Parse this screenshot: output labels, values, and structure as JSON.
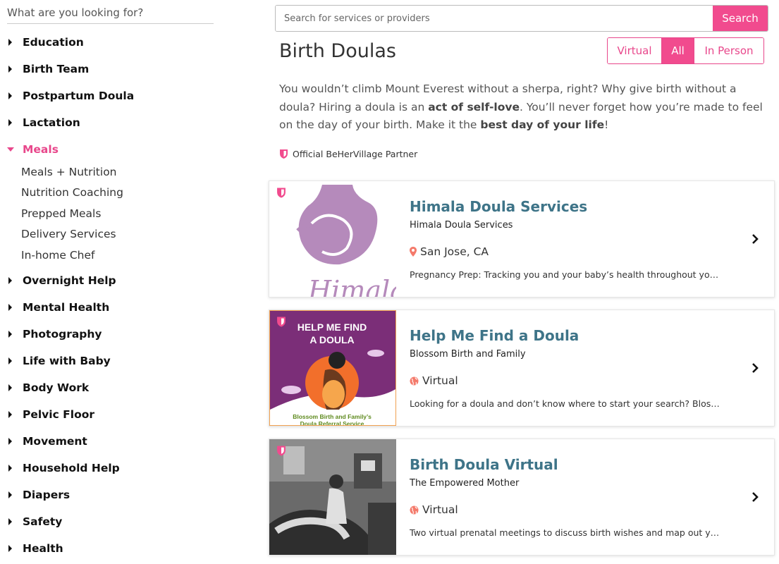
{
  "sidebar": {
    "search_placeholder": "What are you looking for?",
    "categories": [
      {
        "label": "Education"
      },
      {
        "label": "Birth Team"
      },
      {
        "label": "Postpartum Doula"
      },
      {
        "label": "Lactation"
      },
      {
        "label": "Meals"
      },
      {
        "label": "Overnight Help"
      },
      {
        "label": "Mental Health"
      },
      {
        "label": "Photography"
      },
      {
        "label": "Life with Baby"
      },
      {
        "label": "Body Work"
      },
      {
        "label": "Pelvic Floor"
      },
      {
        "label": "Movement"
      },
      {
        "label": "Household Help"
      },
      {
        "label": "Diapers"
      },
      {
        "label": "Safety"
      },
      {
        "label": "Health"
      }
    ],
    "meals_subitems": [
      "Meals + Nutrition",
      "Nutrition Coaching",
      "Prepped Meals",
      "Delivery Services",
      "In-home Chef"
    ]
  },
  "search": {
    "placeholder": "Search for services or providers",
    "button_label": "Search"
  },
  "page_title": "Birth Doulas",
  "filter": {
    "options": [
      "Virtual",
      "All",
      "In Person"
    ],
    "selected": "All"
  },
  "intro": {
    "part1": "You wouldn’t climb Mount Everest without a sherpa, right? Why give birth without a doula? Hiring a doula is an ",
    "bold1": "act of self-love",
    "part2": ". You’ll never forget how you’re made to feel on the day of your birth. Make it the ",
    "bold2": "best day of your life",
    "part3": "!"
  },
  "partner_label": "Official BeHerVillage Partner",
  "colors": {
    "accent": "#f14b8e",
    "title_teal": "#3e7488",
    "thumb_purple": "#b58abb",
    "flyer_purple": "#7b2e78",
    "location_orange": "#f47a6b"
  },
  "listings": [
    {
      "name": "Himala Doula Services",
      "org": "Himala Doula Services",
      "location": "San Jose, CA",
      "location_icon": "map-pin-icon",
      "description": "Pregnancy Prep: Tracking you and your baby’s health throughout your pregnancy"
    },
    {
      "name": "Help Me Find a Doula",
      "org": "Blossom Birth and Family",
      "location": "Virtual",
      "location_icon": "globe-icon",
      "description": "Looking for a doula and don’t know where to start your search? Blossom Birth and Family",
      "flyer_title_line1": "HELP ME FIND",
      "flyer_title_line2": "A DOULA",
      "flyer_footer_line1": "Blossom Birth and Family’s",
      "flyer_footer_line2": "Doula Referral Service"
    },
    {
      "name": "Birth Doula Virtual",
      "org": "The Empowered Mother",
      "location": "Virtual",
      "location_icon": "globe-icon",
      "description": "Two virtual prenatal meetings to discuss birth wishes and map out your plan"
    }
  ]
}
